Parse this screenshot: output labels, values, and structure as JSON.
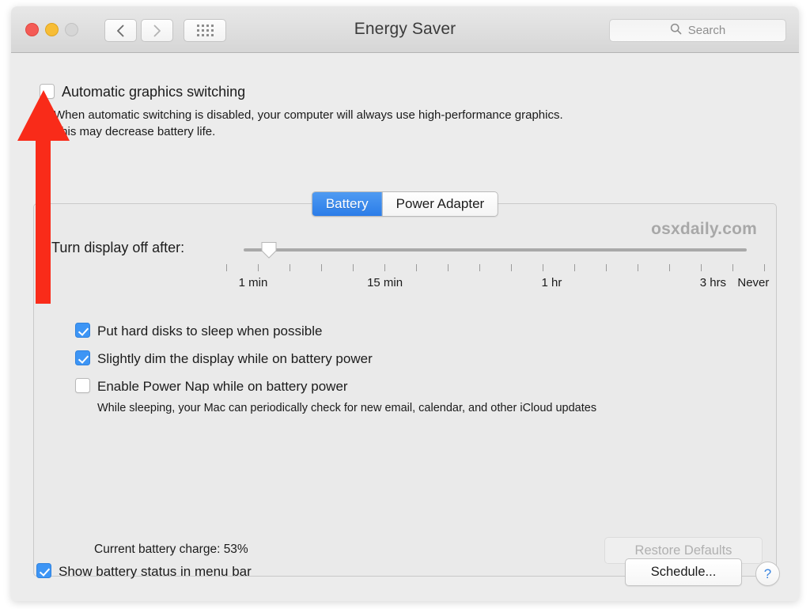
{
  "window": {
    "title": "Energy Saver",
    "traffic_lights": [
      "close-button",
      "minimize-button",
      "zoom-button"
    ],
    "nav": {
      "back": "back-icon",
      "forward": "forward-icon",
      "grid": "show-all-icon"
    },
    "search": {
      "placeholder": "Search",
      "icon": "search-icon",
      "value": ""
    }
  },
  "graphics": {
    "checkbox_label": "Automatic graphics switching",
    "checked": false,
    "desc_line1": "When automatic switching is disabled, your computer will always use high-performance graphics.",
    "desc_line2": "This may decrease battery life."
  },
  "tabs": [
    {
      "label": "Battery",
      "active": true
    },
    {
      "label": "Power Adapter",
      "active": false
    }
  ],
  "slider": {
    "label": "Turn display off after:",
    "value_percent": 5,
    "tick_count": 18,
    "tick_labels": [
      {
        "text": "1 min",
        "position_percent": 5
      },
      {
        "text": "15 min",
        "position_percent": 29.5
      },
      {
        "text": "1 hr",
        "position_percent": 60.5
      },
      {
        "text": "3 hrs",
        "position_percent": 90.5
      },
      {
        "text": "Never",
        "position_percent": 98
      }
    ]
  },
  "watermark": "osxdaily.com",
  "options": [
    {
      "label": "Put hard disks to sleep when possible",
      "checked": true,
      "sub": ""
    },
    {
      "label": "Slightly dim the display while on battery power",
      "checked": true,
      "sub": ""
    },
    {
      "label": "Enable Power Nap while on battery power",
      "checked": false,
      "sub": "While sleeping, your Mac can periodically check for new email, calendar, and other iCloud updates"
    }
  ],
  "battery_charge": "Current battery charge: 53%",
  "restore_defaults": {
    "label": "Restore Defaults",
    "disabled": true
  },
  "bottom": {
    "menu_bar_checkbox": {
      "label": "Show battery status in menu bar",
      "checked": true
    },
    "schedule_label": "Schedule...",
    "help_label": "?"
  },
  "annotation": {
    "arrow_color": "#f92b19",
    "points_to": "automatic-graphics-switching-checkbox"
  }
}
